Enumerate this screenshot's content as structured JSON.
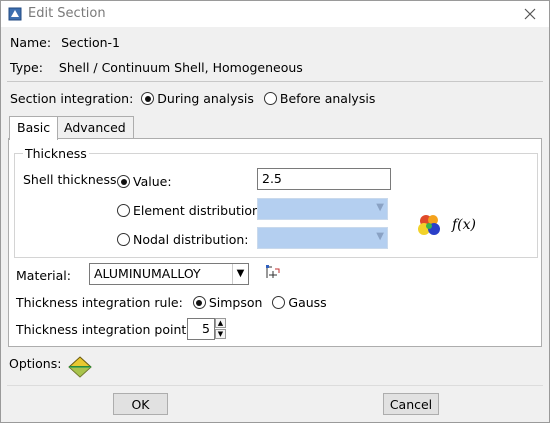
{
  "window": {
    "title": "Edit Section"
  },
  "info": {
    "name_label": "Name:",
    "name_value": "Section-1",
    "type_label": "Type:",
    "type_value": "Shell / Continuum Shell, Homogeneous"
  },
  "integration": {
    "label": "Section integration:",
    "options": [
      "During analysis",
      "Before analysis"
    ],
    "selected": "During analysis"
  },
  "tabs": [
    {
      "label": "Basic",
      "active": true
    },
    {
      "label": "Advanced",
      "active": false
    }
  ],
  "thickness": {
    "group_label": "Thickness",
    "shell_label": "Shell thickness:",
    "value_label": "Value:",
    "value": "2.5",
    "element_dist_label": "Element distribution:",
    "nodal_dist_label": "Nodal distribution:",
    "fx_label": "f(x)"
  },
  "material": {
    "label": "Material:",
    "value": "ALUMINUMALLOY"
  },
  "rule": {
    "label": "Thickness integration rule:",
    "options": [
      "Simpson",
      "Gauss"
    ],
    "selected": "Simpson"
  },
  "points": {
    "label": "Thickness integration points:",
    "value": "5"
  },
  "options": {
    "label": "Options:"
  },
  "buttons": {
    "ok": "OK",
    "cancel": "Cancel"
  }
}
